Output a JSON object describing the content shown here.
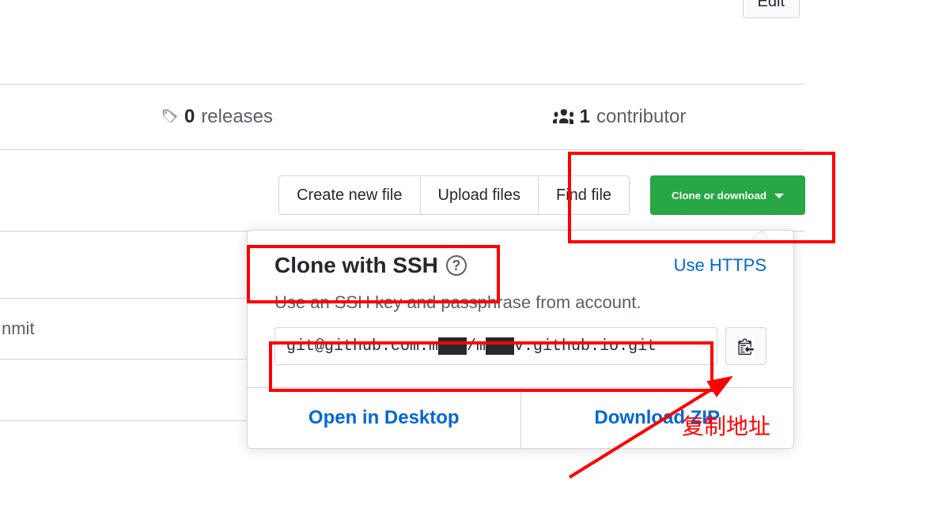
{
  "edit_button": "Edit",
  "stats": {
    "releases_count": "0",
    "releases_label": "releases",
    "contributor_count": "1",
    "contributor_label": "contributor"
  },
  "actions": {
    "create_new_file": "Create new file",
    "upload_files": "Upload files",
    "find_file": "Find file",
    "clone_or_download": "Clone or download"
  },
  "row": {
    "commit_label": "nmit"
  },
  "clone": {
    "title": "Clone with SSH",
    "use_https": "Use HTTPS",
    "description": "Use an SSH key and passphrase from account.",
    "url_value": "git@github.com:m███/m███v.github.io.git",
    "open_in_desktop": "Open in Desktop",
    "download_zip": "Download ZIP"
  },
  "annotations": {
    "copy_address": "复制地址"
  }
}
